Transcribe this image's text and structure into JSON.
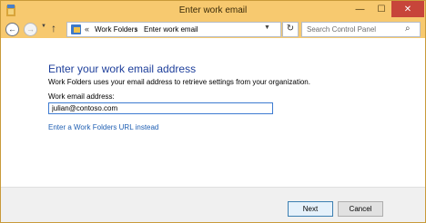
{
  "window": {
    "title": "Enter work email",
    "controls": {
      "minimize": "—",
      "maximize": "☐",
      "close": "✕"
    }
  },
  "nav": {
    "back_icon": "left-arrow-icon",
    "forward_icon": "right-arrow-icon",
    "up_icon": "up-arrow-icon",
    "breadcrumb": {
      "overflow": "«",
      "items": [
        "Work Folders",
        "Enter work email"
      ],
      "separator": "›"
    },
    "search": {
      "placeholder": "Search Control Panel"
    }
  },
  "main": {
    "heading": "Enter your work email address",
    "description": "Work Folders uses your email address to retrieve settings from your organization.",
    "field_label": "Work email address:",
    "email_value": "julian@contoso.com",
    "link_text": "Enter a Work Folders URL instead"
  },
  "footer": {
    "next_label": "Next",
    "cancel_label": "Cancel"
  },
  "colors": {
    "titlebar": "#f7c96f",
    "heading": "#1e3f9b",
    "link": "#1f5fb3",
    "close": "#c7453a"
  }
}
